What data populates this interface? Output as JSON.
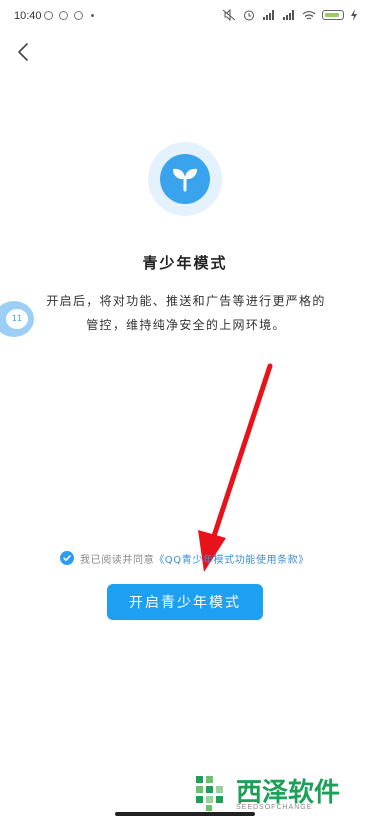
{
  "status_bar": {
    "time": "10:40"
  },
  "page": {
    "title": "青少年模式",
    "description": "开启后，将对功能、推送和广告等进行更严格的管控，维持纯净安全的上网环境。",
    "agreement_prefix": "我已阅读并同意",
    "agreement_link": "《QQ青少年模式功能使用条款》",
    "enable_button": "开启青少年模式"
  },
  "floating_bubble": {
    "text": "11"
  },
  "watermark": {
    "name": "西泽软件",
    "sub": "SEEDSOFCHANGE"
  },
  "colors": {
    "accent": "#1ea0f2",
    "link": "#3b8fd6",
    "annotation_arrow": "#e8121a",
    "watermark": "#1fa05a"
  }
}
